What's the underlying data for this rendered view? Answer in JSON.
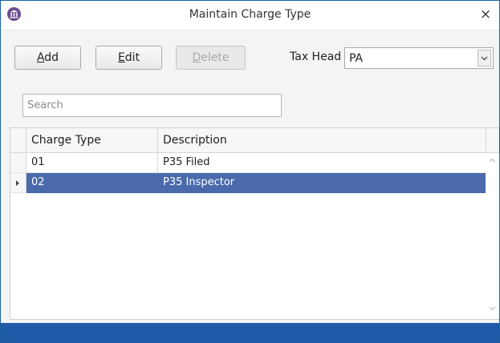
{
  "window": {
    "title": "Maintain Charge Type",
    "close_glyph": "×",
    "icon": "columns-seal-icon"
  },
  "toolbar": {
    "add": {
      "prefix": "",
      "mnemonic": "A",
      "suffix": "dd"
    },
    "edit": {
      "prefix": "",
      "mnemonic": "E",
      "suffix": "dit"
    },
    "delete": {
      "prefix": "",
      "mnemonic": "D",
      "suffix": "elete",
      "disabled": true
    },
    "tax_head_label": "Tax Head",
    "tax_head_value": "PA"
  },
  "search": {
    "placeholder": "Search",
    "value": ""
  },
  "grid": {
    "columns": [
      "Charge Type",
      "Description"
    ],
    "rows": [
      {
        "charge_type": "01",
        "description": "P35 Filed",
        "selected": false
      },
      {
        "charge_type": "02",
        "description": "P35 Inspector",
        "selected": true
      }
    ]
  },
  "colors": {
    "selection": "#4a6aab",
    "statusbar": "#1e5aa8",
    "app_icon": "#6a4a93"
  }
}
